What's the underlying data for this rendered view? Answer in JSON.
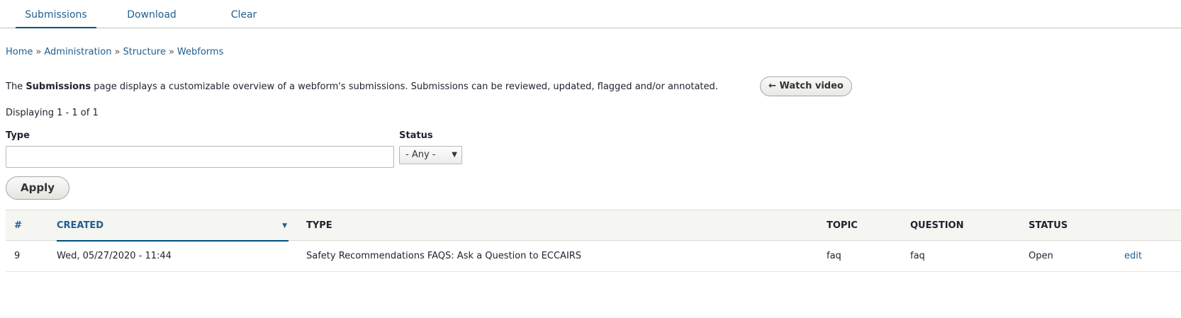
{
  "tabs": [
    {
      "label": "Submissions",
      "active": true
    },
    {
      "label": "Download",
      "active": false
    },
    {
      "label": "Clear",
      "active": false
    }
  ],
  "breadcrumb": [
    "Home",
    "Administration",
    "Structure",
    "Webforms"
  ],
  "breadcrumb_separator": "»",
  "description": {
    "prefix": "The ",
    "bold": "Submissions",
    "suffix": " page displays a customizable overview of a webform's submissions. Submissions can be reviewed, updated, flagged and/or annotated.",
    "video_button": "← Watch video"
  },
  "displaying": "Displaying 1 - 1 of 1",
  "filters": {
    "type_label": "Type",
    "type_value": "",
    "status_label": "Status",
    "status_value": "- Any -",
    "apply_label": "Apply"
  },
  "table": {
    "headers": {
      "num": "#",
      "created": "CREATED",
      "type": "TYPE",
      "topic": "TOPIC",
      "question": "QUESTION",
      "status": "STATUS"
    },
    "rows": [
      {
        "num": "9",
        "created": "Wed, 05/27/2020 - 11:44",
        "type": "Safety Recommendations FAQS: Ask a Question to ECCAIRS",
        "topic": "faq",
        "question": "faq",
        "status": "Open",
        "operation": "edit"
      }
    ]
  },
  "colors": {
    "link": "#1f5e8f",
    "accent": "#004f80"
  }
}
